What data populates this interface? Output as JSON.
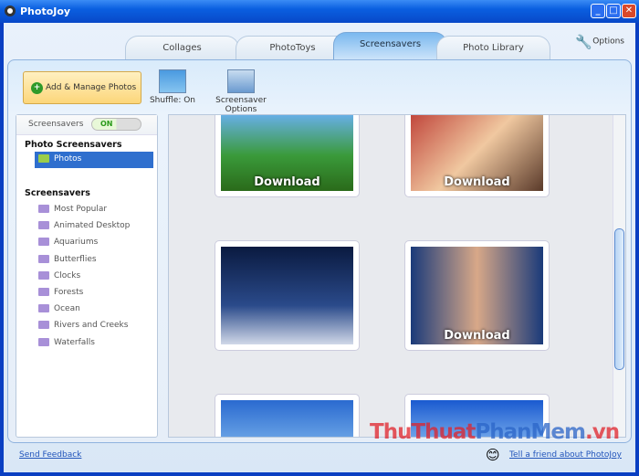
{
  "window": {
    "title": "PhotoJoy"
  },
  "tabs": [
    {
      "label": "Collages"
    },
    {
      "label": "PhotoToys"
    },
    {
      "label": "Screensavers"
    },
    {
      "label": "Photo Library"
    }
  ],
  "options_label": "Options",
  "toolbar": {
    "add_label": "Add & Manage Photos",
    "shuffle_label": "Shuffle: On",
    "ss_options_label": "Screensaver Options"
  },
  "sidebar": {
    "header": "Screensavers",
    "toggle": "ON",
    "photo_group": "Photo Screensavers",
    "selected": "Photos",
    "group": "Screensavers",
    "items": [
      "Most Popular",
      "Animated Desktop",
      "Aquariums",
      "Butterflies",
      "Clocks",
      "Forests",
      "Ocean",
      "Rivers and Creeks",
      "Waterfalls"
    ]
  },
  "gallery": {
    "download_label": "Download"
  },
  "footer": {
    "feedback": "Send Feedback",
    "tell": "Tell a friend about PhotoJoy"
  },
  "watermark": "ThuThuatPhanMem.vn",
  "colors": {
    "accent": "#2f6fce",
    "title": "#0a5fe0"
  }
}
